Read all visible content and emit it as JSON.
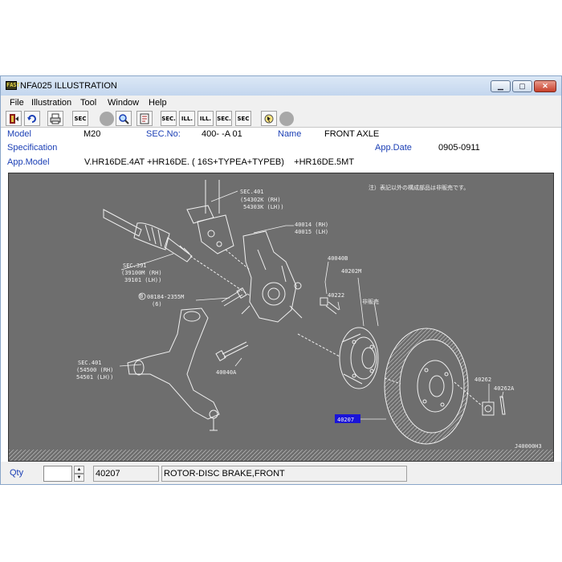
{
  "window": {
    "title": "NFA025  ILLUSTRATION",
    "app_icon_text": "FAST",
    "min_glyph": "▁",
    "max_glyph": "▢",
    "close_glyph": "✕"
  },
  "menu": [
    "File",
    "Illustration",
    "Tool",
    "Window",
    "Help"
  ],
  "toolbar": {
    "icons": [
      "exit-icon",
      "back-icon",
      "print-icon",
      "sec-icon",
      "status-light-icon",
      "find-icon",
      "book-icon",
      "sec-prev-icon",
      "ill-prev-icon",
      "ill-next-icon",
      "sec-next-icon",
      "sec-query-icon",
      "pointer-icon",
      "status-light-icon"
    ],
    "labels": {
      "sec": "SEC",
      "sec_prev": "SEC.",
      "ill_prev": "ILL.",
      "ill_next": "ILL.",
      "sec_next": "SEC.",
      "sec_query": "SEC"
    }
  },
  "info": {
    "model_label": "Model",
    "model_value": "M20",
    "secno_label": "SEC.No:",
    "secno_value": "400-  -A 01",
    "name_label": "Name",
    "name_value": "FRONT AXLE",
    "spec_label": "Specification",
    "appdate_label": "App.Date",
    "appdate_value": "0905-0911",
    "appmodel_label": "App.Model",
    "appmodel_value": "V.HR16DE.4AT +HR16DE. ( 16S+TYPEA+TYPEB)    +HR16DE.5MT"
  },
  "illustration": {
    "note": "注）表記以外の構成部品は非販売です。",
    "labels": {
      "sec401_top": "SEC.401",
      "p54302k": "(54302K (RH)",
      "p54303k": "54303K (LH))",
      "p40014": "40014 (RH)",
      "p40015": "40015 (LH)",
      "sec391": "SEC.391",
      "p39100m": "(39100M (RH)",
      "p39101": "39101 (LH))",
      "p40040b": "40040B",
      "p40202m": "40202M",
      "p40222": "40222",
      "hihanbai": "非販売",
      "p08184": "08184-2355M",
      "p08184_qty": "(6)",
      "sec401_bot": "SEC.401",
      "p54500": "(54500 (RH)",
      "p54501": "54501 (LH))",
      "p40040a": "40040A",
      "p40262": "40262",
      "p40262a": "40262A",
      "p40207": "40207",
      "drawing_no": "J40000H3"
    }
  },
  "status": {
    "qty_label": "Qty",
    "qty_value": "",
    "part_number": "40207",
    "part_name": "ROTOR-DISC BRAKE,FRONT"
  },
  "colors": {
    "label_blue": "#1b3fb5",
    "illustration_bg": "#6e6e6e",
    "highlight": "#1a14d8"
  }
}
